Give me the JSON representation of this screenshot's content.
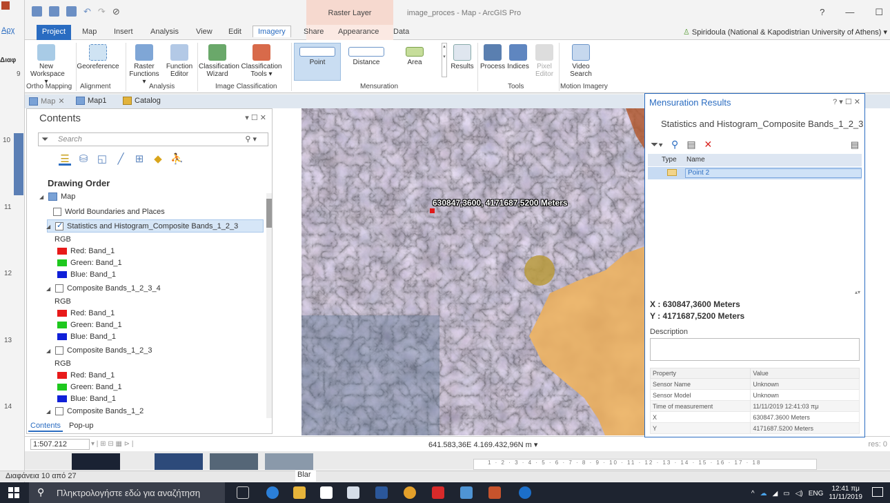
{
  "left_slide_nums": [
    "9",
    "10",
    "11",
    "12",
    "13",
    "14"
  ],
  "ppt_tab": "Αρχ",
  "ppt_group": "Διαφ",
  "window_title": "image_proces - Map - ArcGIS Pro",
  "context_tab_group": "Raster Layer",
  "window_controls": {
    "help": "?",
    "minimize": "—",
    "maximize": "☐"
  },
  "tabs": [
    "Project",
    "Map",
    "Insert",
    "Analysis",
    "View",
    "Edit",
    "Imagery",
    "Share",
    "Appearance",
    "Data"
  ],
  "user": "Spiridoula (National & Kapodistrian University of Athens)",
  "ribbon": {
    "new_workspace": "New Workspace ▾",
    "georeference": "Georeference",
    "raster_functions": "Raster Functions ▾",
    "function_editor": "Function Editor",
    "class_wizard": "Classification Wizard",
    "class_tools": "Classification Tools ▾",
    "point": "Point",
    "distance": "Distance",
    "area": "Area",
    "results": "Results",
    "process": "Process",
    "indices": "Indices",
    "pixel_editor": "Pixel Editor",
    "video_search": "Video Search",
    "groups": {
      "ortho": "Ortho Mapping",
      "alignment": "Alignment",
      "analysis": "Analysis",
      "image_class": "Image Classification",
      "mensuration": "Mensuration",
      "tools": "Tools",
      "motion": "Motion Imagery"
    }
  },
  "doc_tabs": {
    "map": "Map",
    "map1": "Map1",
    "catalog": "Catalog"
  },
  "contents": {
    "title": "Contents",
    "search_placeholder": "Search",
    "drawing_order": "Drawing Order",
    "map": "Map",
    "world": "World Boundaries and Places",
    "layer1": "Statistics and Histogram_Composite Bands_1_2_3",
    "rgb": "RGB",
    "red": "Red:  Band_1",
    "green": "Green: Band_1",
    "blue": "Blue:  Band_1",
    "layer2": "Composite Bands_1_2_3_4",
    "layer3": "Composite Bands_1_2_3",
    "layer4": "Composite Bands_1_2",
    "tab_contents": "Contents",
    "tab_popup": "Pop-up"
  },
  "map": {
    "coord_label": "630847,3600, 4171687,5200 Meters",
    "scale": "1:507.212",
    "status_coords": "641.583,36E 4.169.432,96N m",
    "res_right": "res: 0"
  },
  "mensuration": {
    "title": "Mensuration Results",
    "subtitle": "Statistics and Histogram_Composite Bands_1_2_3",
    "col_type": "Type",
    "col_name": "Name",
    "point_name": "Point 2",
    "x": "X : 630847,3600 Meters",
    "y": "Y : 4171687,5200 Meters",
    "description": "Description",
    "table_header": [
      "Property",
      "Value"
    ],
    "rows": [
      [
        "Sensor Name",
        "Unknown"
      ],
      [
        "Sensor Model",
        "Unknown"
      ],
      [
        "Time of measurement",
        "11/11/2019 12:41:03 πμ"
      ],
      [
        "X",
        "630847.3600 Meters"
      ],
      [
        "Y",
        "4171687.5200 Meters"
      ]
    ]
  },
  "slide_status": "Διαφάνεια 10 από 27",
  "blar": "Blar",
  "ruler": "1 · 2 · 3 · 4 · 5 · 6 · 7 · 8 · 9 · 10 · 11 · 12 · 13 · 14 · 15 · 16 · 17 · 18",
  "taskbar": {
    "search": "Πληκτρολογήστε εδώ για αναζήτηση",
    "lang": "ENG",
    "time": "12:41 πμ",
    "date": "11/11/2019"
  }
}
